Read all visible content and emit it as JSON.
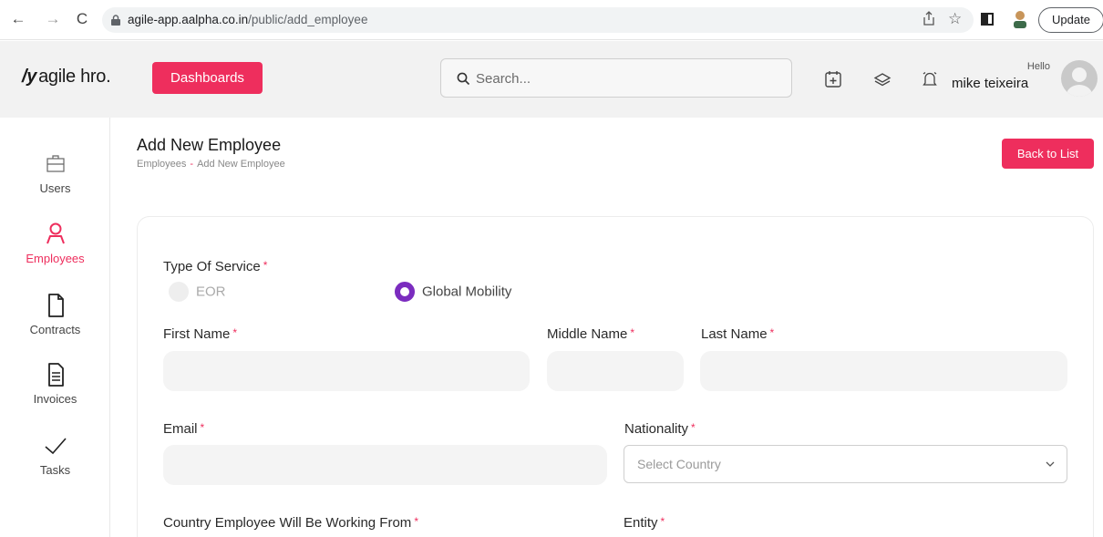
{
  "browser": {
    "url_host": "agile-app.aalpha.co.in",
    "url_path": "/public/add_employee",
    "update_label": "Update"
  },
  "header": {
    "logo_mark": "/y",
    "logo_text": "agile hro.",
    "dashboards_label": "Dashboards",
    "search_placeholder": "Search...",
    "greeting": "Hello",
    "user_name": "mike teixeira"
  },
  "sidebar": {
    "items": [
      {
        "label": "Users",
        "icon": "briefcase-icon",
        "active": false
      },
      {
        "label": "Employees",
        "icon": "user-icon",
        "active": true
      },
      {
        "label": "Contracts",
        "icon": "document-icon",
        "active": false
      },
      {
        "label": "Invoices",
        "icon": "invoice-icon",
        "active": false
      },
      {
        "label": "Tasks",
        "icon": "check-icon",
        "active": false
      }
    ]
  },
  "page": {
    "title": "Add New Employee",
    "breadcrumb": [
      "Employees",
      "Add New Employee"
    ],
    "breadcrumb_sep": "-",
    "back_label": "Back to List"
  },
  "form": {
    "required_mark": "*",
    "type_of_service_label": "Type Of Service",
    "service_options": [
      {
        "label": "EOR",
        "selected": false
      },
      {
        "label": "Global Mobility",
        "selected": true
      }
    ],
    "first_name_label": "First Name",
    "middle_name_label": "Middle Name",
    "last_name_label": "Last Name",
    "email_label": "Email",
    "nationality_label": "Nationality",
    "nationality_placeholder": "Select Country",
    "working_country_label": "Country Employee Will Be Working From",
    "entity_label": "Entity"
  },
  "colors": {
    "accent": "#ee2e5d",
    "radio_selected": "#7b2cbf"
  }
}
